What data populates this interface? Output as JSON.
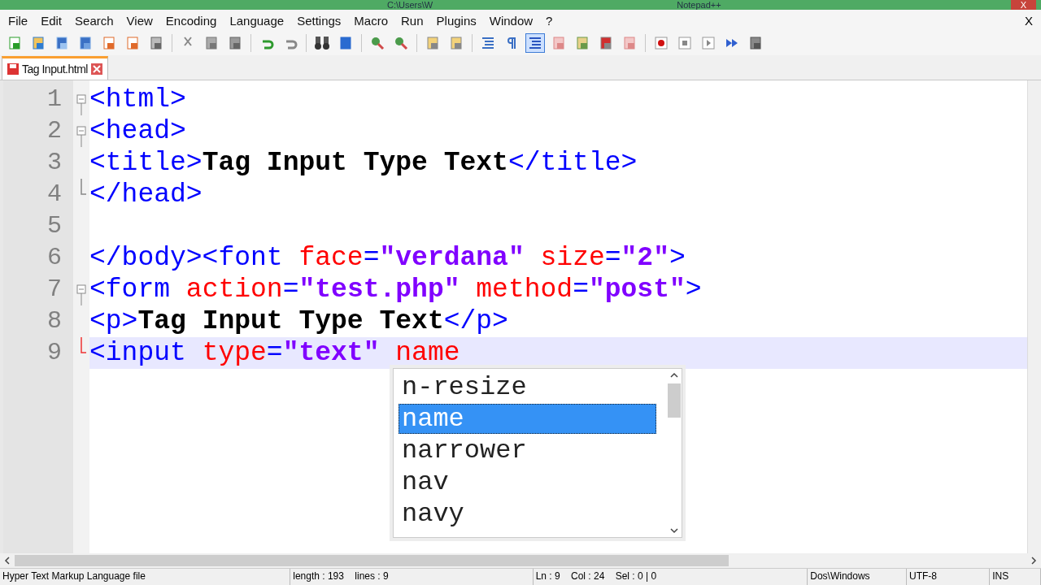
{
  "title_bar": {
    "path": "C:\\Users\\W",
    "app": "Notepad++",
    "close": "X"
  },
  "menu": [
    "File",
    "Edit",
    "Search",
    "View",
    "Encoding",
    "Language",
    "Settings",
    "Macro",
    "Run",
    "Plugins",
    "Window",
    "?"
  ],
  "menu_close": "X",
  "toolbar": [
    [
      {
        "kind": "new",
        "pressed": false
      },
      {
        "kind": "open",
        "pressed": false
      },
      {
        "kind": "save",
        "pressed": false
      },
      {
        "kind": "saveall",
        "pressed": false
      },
      {
        "kind": "close",
        "pressed": false
      },
      {
        "kind": "closeall",
        "pressed": false
      },
      {
        "kind": "print",
        "pressed": false
      }
    ],
    [
      {
        "kind": "cut",
        "pressed": false
      },
      {
        "kind": "copy",
        "pressed": false
      },
      {
        "kind": "paste",
        "pressed": false
      }
    ],
    [
      {
        "kind": "undo",
        "pressed": false
      },
      {
        "kind": "redo",
        "pressed": false
      }
    ],
    [
      {
        "kind": "find",
        "pressed": false
      },
      {
        "kind": "replace",
        "pressed": false
      }
    ],
    [
      {
        "kind": "zoomin",
        "pressed": false
      },
      {
        "kind": "zoomout",
        "pressed": false
      }
    ],
    [
      {
        "kind": "sync",
        "pressed": false
      },
      {
        "kind": "sync",
        "pressed": false
      }
    ],
    [
      {
        "kind": "wrap",
        "pressed": false
      },
      {
        "kind": "pilcrow",
        "pressed": false
      },
      {
        "kind": "indent",
        "pressed": true
      },
      {
        "kind": "folder",
        "pressed": false
      },
      {
        "kind": "map",
        "pressed": false
      },
      {
        "kind": "func",
        "pressed": false
      },
      {
        "kind": "folder",
        "pressed": false
      }
    ],
    [
      {
        "kind": "record",
        "pressed": false
      },
      {
        "kind": "stop",
        "pressed": false
      },
      {
        "kind": "play",
        "pressed": false
      },
      {
        "kind": "playmulti",
        "pressed": false
      },
      {
        "kind": "savemacro",
        "pressed": false
      }
    ]
  ],
  "tabs": [
    {
      "label": "Tag Input.html",
      "selected": true
    }
  ],
  "editor": {
    "lines": [
      {
        "number": "1",
        "fold_open": true,
        "fold_end": false,
        "current": false,
        "tokens": [
          {
            "kind": "tag",
            "text": "<html>"
          }
        ]
      },
      {
        "number": "2",
        "fold_open": true,
        "fold_end": false,
        "current": false,
        "tokens": [
          {
            "kind": "tag",
            "text": "<head>"
          }
        ]
      },
      {
        "number": "3",
        "fold_open": false,
        "fold_end": false,
        "current": false,
        "tokens": [
          {
            "kind": "tag",
            "text": "<title>"
          },
          {
            "kind": "text",
            "text": "Tag Input Type Text"
          },
          {
            "kind": "tag",
            "text": "</title>"
          }
        ]
      },
      {
        "number": "4",
        "fold_open": false,
        "fold_end": true,
        "current": false,
        "tokens": [
          {
            "kind": "tag",
            "text": "</head>"
          }
        ]
      },
      {
        "number": "5",
        "fold_open": false,
        "fold_end": false,
        "current": false
      },
      {
        "number": "6",
        "fold_open": false,
        "fold_end": false,
        "current": false,
        "tokens": [
          {
            "kind": "tag",
            "text": "</body><font "
          },
          {
            "kind": "attr",
            "text": "face"
          },
          {
            "kind": "tag",
            "text": "="
          },
          {
            "kind": "value",
            "text": "\"verdana\""
          },
          {
            "kind": "attr",
            "text": " size"
          },
          {
            "kind": "tag",
            "text": "="
          },
          {
            "kind": "value",
            "text": "\"2\""
          },
          {
            "kind": "tag",
            "text": ">"
          }
        ]
      },
      {
        "number": "7",
        "fold_open": true,
        "fold_end": false,
        "current": false,
        "tokens": [
          {
            "kind": "tag",
            "text": "<form "
          },
          {
            "kind": "attr",
            "text": "action"
          },
          {
            "kind": "tag",
            "text": "="
          },
          {
            "kind": "value",
            "text": "\"test.php\""
          },
          {
            "kind": "attr",
            "text": " method"
          },
          {
            "kind": "tag",
            "text": "="
          },
          {
            "kind": "value",
            "text": "\"post\""
          },
          {
            "kind": "tag",
            "text": ">"
          }
        ]
      },
      {
        "number": "8",
        "fold_open": false,
        "fold_end": false,
        "current": false,
        "tokens": [
          {
            "kind": "tag",
            "text": "<p>"
          },
          {
            "kind": "text",
            "text": "Tag Input Type Text"
          },
          {
            "kind": "tag",
            "text": "</p>"
          }
        ]
      },
      {
        "number": "9",
        "fold_open": false,
        "fold_end": true,
        "current": true,
        "tokens": [
          {
            "kind": "tag",
            "text": "<input "
          },
          {
            "kind": "attr",
            "text": "type"
          },
          {
            "kind": "tag",
            "text": "="
          },
          {
            "kind": "value",
            "text": "\"text\""
          },
          {
            "kind": "attr",
            "text": " name"
          }
        ]
      }
    ]
  },
  "autocomplete": {
    "items": [
      {
        "text": "n-resize",
        "selected": false
      },
      {
        "text": "name",
        "selected": true
      },
      {
        "text": "narrower",
        "selected": false
      },
      {
        "text": "nav",
        "selected": false
      },
      {
        "text": "navy",
        "selected": false
      }
    ]
  },
  "status_bar": [
    "Hyper Text Markup Language file",
    "length : 193    lines : 9",
    "Ln : 9    Col : 24    Sel : 0 | 0",
    "Dos\\Windows",
    "UTF-8",
    "INS"
  ]
}
